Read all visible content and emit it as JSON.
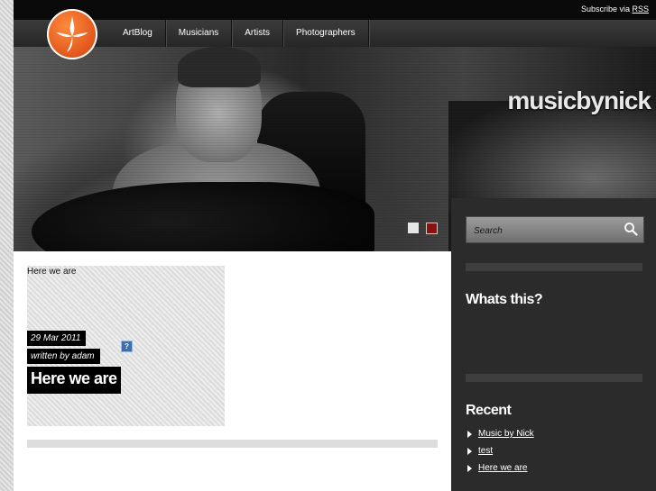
{
  "header": {
    "subscribe_text": "Subscribe via",
    "subscribe_link": "RSS"
  },
  "nav": {
    "items": [
      {
        "label": "ArtBlog"
      },
      {
        "label": "Musicians"
      },
      {
        "label": "Artists"
      },
      {
        "label": "Photographers"
      }
    ]
  },
  "hero": {
    "site_title": "musicbynick",
    "slider_active_color": "#8b1010"
  },
  "post": {
    "excerpt": "Here we are",
    "date": "29 Mar 2011",
    "author": "written by adam",
    "title": "Here we are",
    "help_icon_label": "?"
  },
  "sidebar": {
    "search": {
      "placeholder": "Search"
    },
    "whats_this_heading": "Whats this?",
    "recent_heading": "Recent",
    "recent_items": [
      {
        "label": "Music by Nick"
      },
      {
        "label": "test"
      },
      {
        "label": "Here we are"
      }
    ]
  },
  "colors": {
    "accent": "#e0541a",
    "sidebar_bg": "#2b2b2b",
    "topbar_bg": "#0a0a0a"
  }
}
